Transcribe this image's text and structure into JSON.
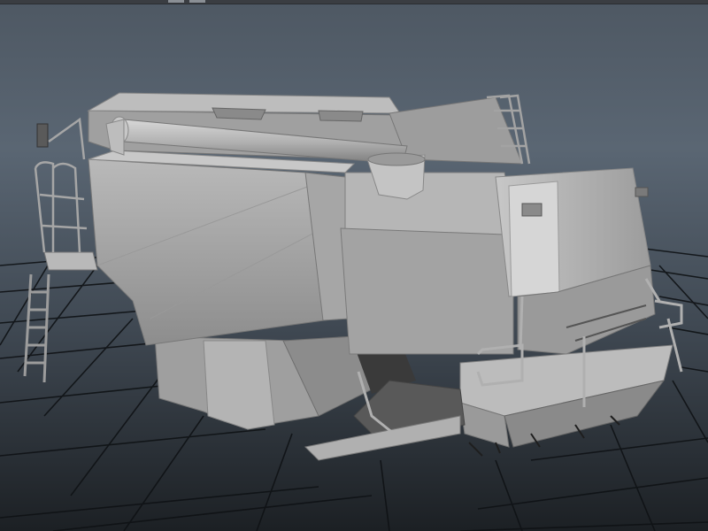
{
  "viewport": {
    "background_top": "#4e5863",
    "background_bottom": "#1c2024",
    "grid_color": "#0f1215",
    "model_fill": "#a9a9a9"
  },
  "model": {
    "object": "combine-harvester",
    "shading": "smooth-shaded-gray"
  }
}
